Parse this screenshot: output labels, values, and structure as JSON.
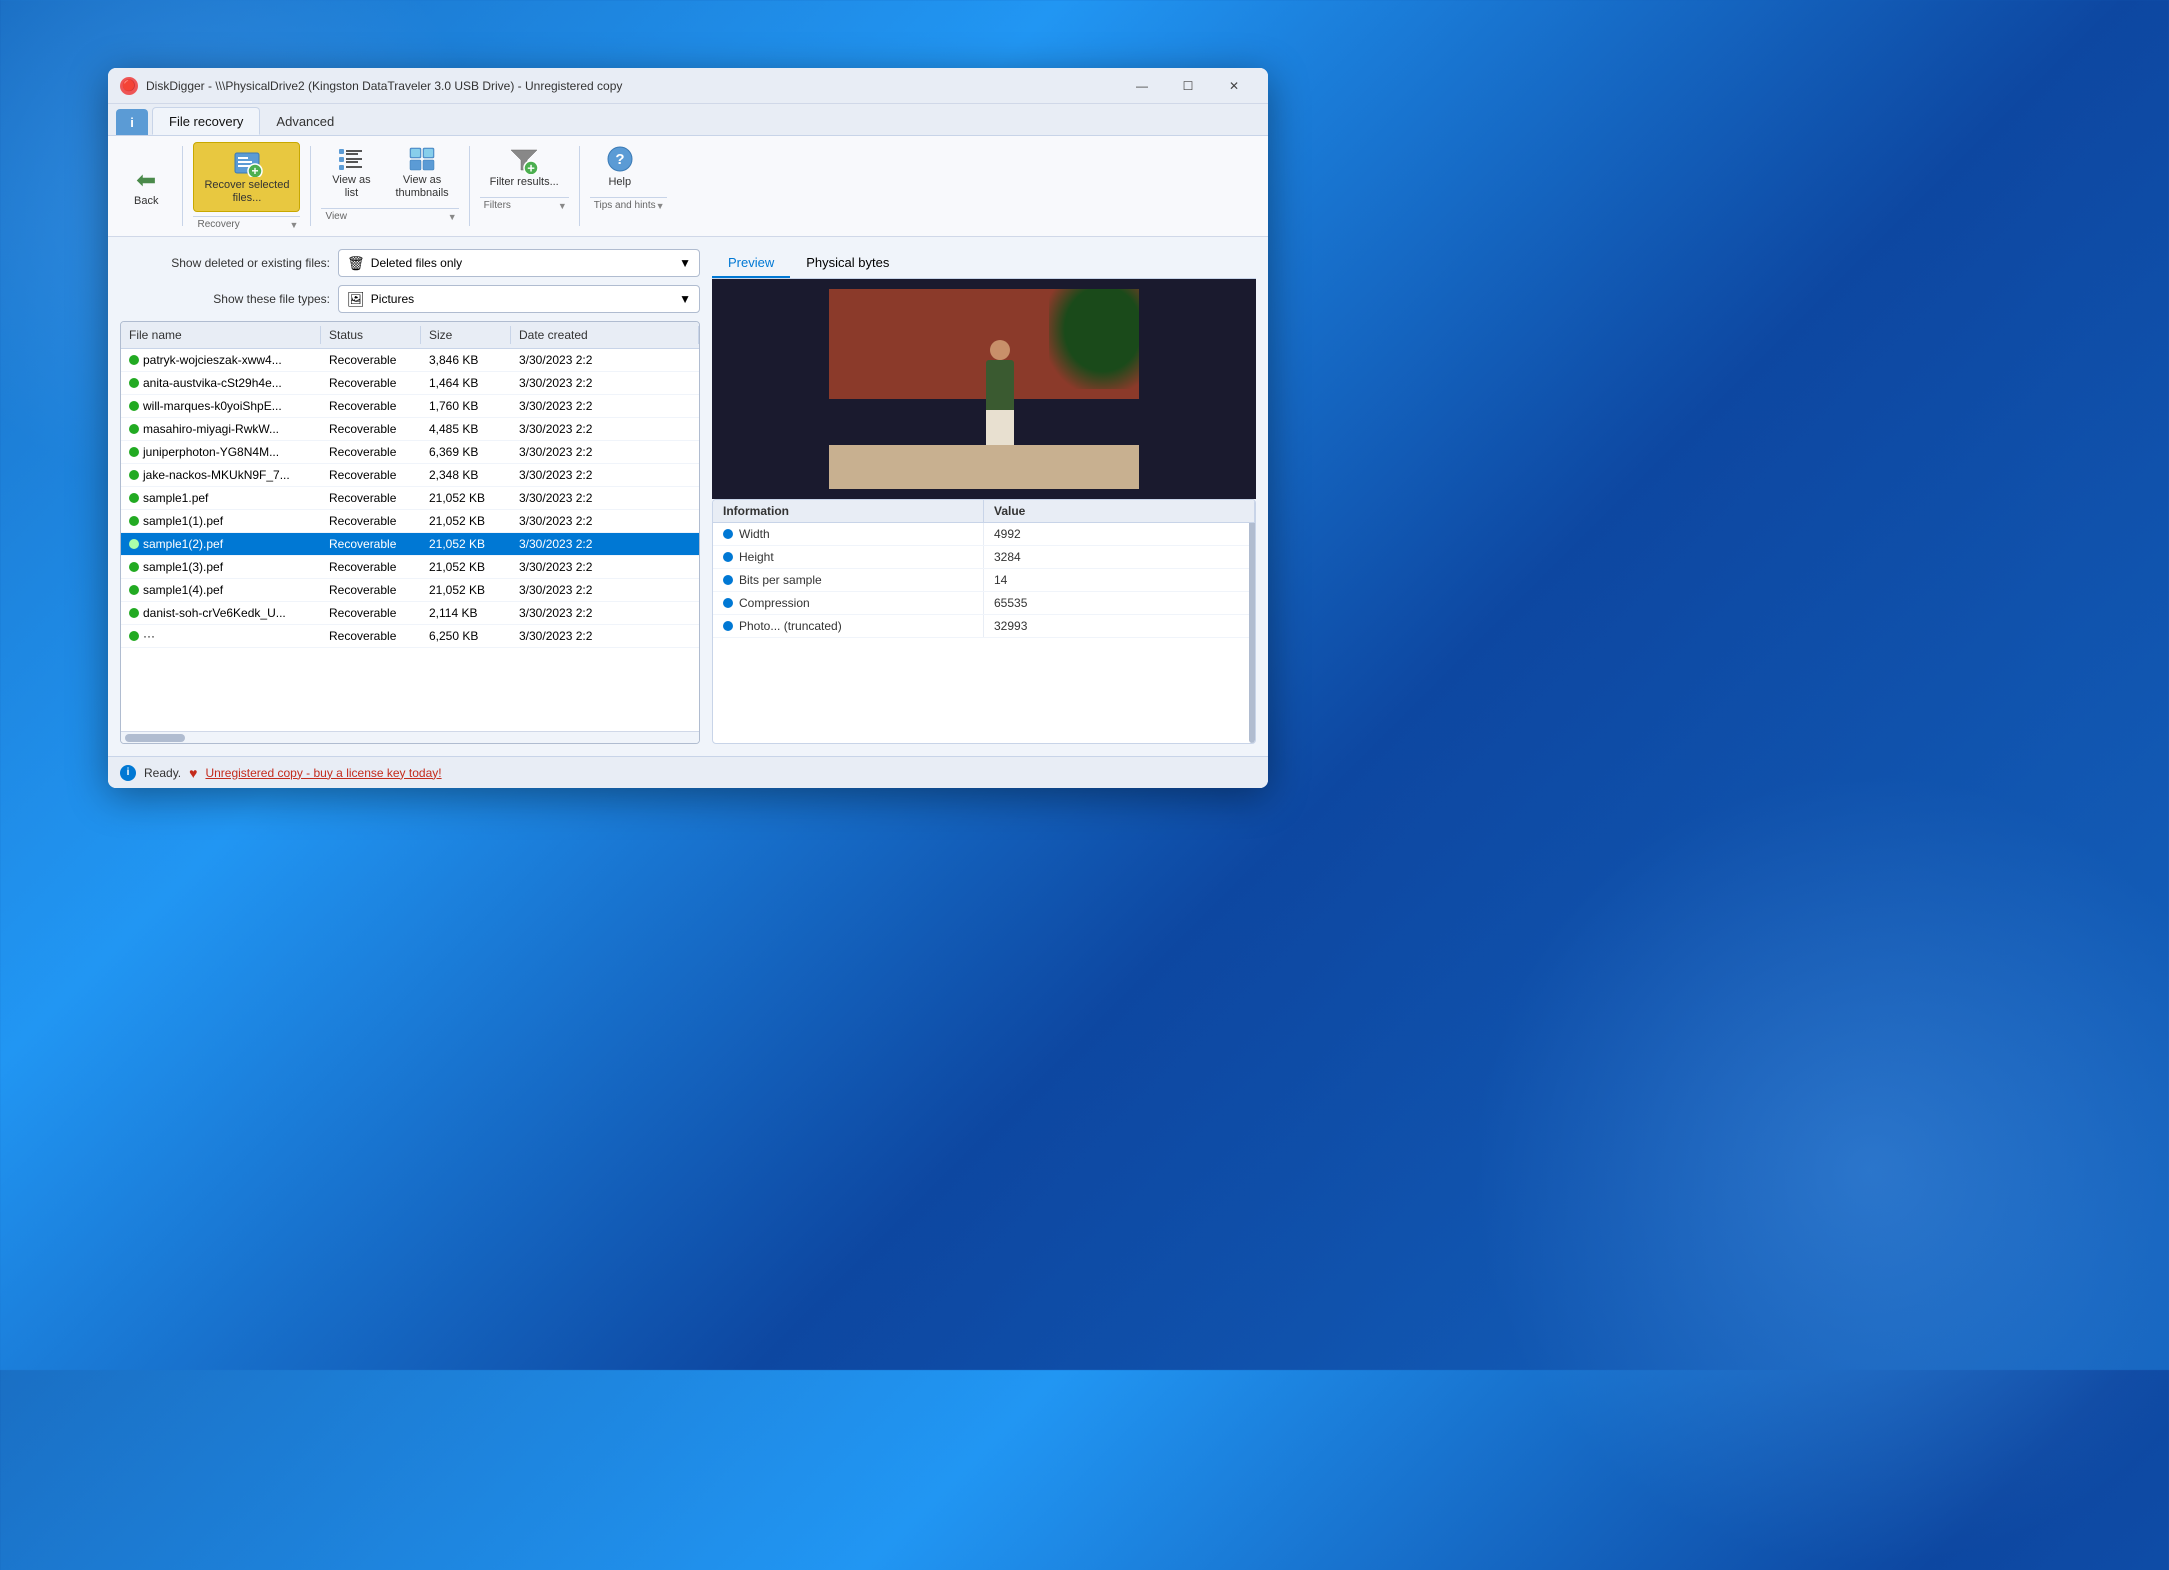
{
  "window": {
    "title": "DiskDigger - \\\\\\PhysicalDrive2 (Kingston DataTraveler 3.0 USB Drive) - Unregistered copy",
    "title_icon": "🔴",
    "controls": {
      "minimize": "—",
      "maximize": "☐",
      "close": "✕"
    }
  },
  "tabs": {
    "info_label": "i",
    "file_recovery_label": "File recovery",
    "advanced_label": "Advanced"
  },
  "toolbar": {
    "back_label": "Back",
    "recover_label": "Recover selected\nfiles...",
    "view_list_label": "View as\nlist",
    "view_thumb_label": "View as\nthumbnails",
    "filter_label": "Filter results...",
    "help_label": "Help",
    "groups": {
      "recovery_label": "Recovery",
      "view_label": "View",
      "filters_label": "Filters",
      "tips_label": "Tips and hints"
    }
  },
  "filters": {
    "deleted_label": "Show deleted or existing files:",
    "deleted_value": "Deleted files only",
    "deleted_icon": "🗑",
    "types_label": "Show these file types:",
    "types_value": "Pictures",
    "types_icon": "🖼"
  },
  "file_list": {
    "columns": [
      "File name",
      "Status",
      "Size",
      "Date created"
    ],
    "files": [
      {
        "name": "patryk-wojcieszak-xww4...",
        "status": "Recoverable",
        "size": "3,846 KB",
        "date": "3/30/2023 2:2",
        "selected": false
      },
      {
        "name": "anita-austvika-cSt29h4e...",
        "status": "Recoverable",
        "size": "1,464 KB",
        "date": "3/30/2023 2:2",
        "selected": false
      },
      {
        "name": "will-marques-k0yoiShpE...",
        "status": "Recoverable",
        "size": "1,760 KB",
        "date": "3/30/2023 2:2",
        "selected": false
      },
      {
        "name": "masahiro-miyagi-RwkW...",
        "status": "Recoverable",
        "size": "4,485 KB",
        "date": "3/30/2023 2:2",
        "selected": false
      },
      {
        "name": "juniperphoton-YG8N4M...",
        "status": "Recoverable",
        "size": "6,369 KB",
        "date": "3/30/2023 2:2",
        "selected": false
      },
      {
        "name": "jake-nackos-MKUkN9F_7...",
        "status": "Recoverable",
        "size": "2,348 KB",
        "date": "3/30/2023 2:2",
        "selected": false
      },
      {
        "name": "sample1.pef",
        "status": "Recoverable",
        "size": "21,052 KB",
        "date": "3/30/2023 2:2",
        "selected": false
      },
      {
        "name": "sample1(1).pef",
        "status": "Recoverable",
        "size": "21,052 KB",
        "date": "3/30/2023 2:2",
        "selected": false
      },
      {
        "name": "sample1(2).pef",
        "status": "Recoverable",
        "size": "21,052 KB",
        "date": "3/30/2023 2:2",
        "selected": true
      },
      {
        "name": "sample1(3).pef",
        "status": "Recoverable",
        "size": "21,052 KB",
        "date": "3/30/2023 2:2",
        "selected": false
      },
      {
        "name": "sample1(4).pef",
        "status": "Recoverable",
        "size": "21,052 KB",
        "date": "3/30/2023 2:2",
        "selected": false
      },
      {
        "name": "danist-soh-crVe6Kedk_U...",
        "status": "Recoverable",
        "size": "2,114 KB",
        "date": "3/30/2023 2:2",
        "selected": false
      },
      {
        "name": "···",
        "status": "Recoverable",
        "size": "6,250 KB",
        "date": "3/30/2023 2:2",
        "selected": false
      }
    ]
  },
  "preview": {
    "tab_preview": "Preview",
    "tab_physical": "Physical bytes"
  },
  "info_table": {
    "col_information": "Information",
    "col_value": "Value",
    "rows": [
      {
        "label": "Width",
        "value": "4992",
        "has_dot": true
      },
      {
        "label": "Height",
        "value": "3284",
        "has_dot": true
      },
      {
        "label": "Bits per sample",
        "value": "14",
        "has_dot": true
      },
      {
        "label": "Compression",
        "value": "65535",
        "has_dot": true
      },
      {
        "label": "Photo... (truncated)",
        "value": "32993",
        "has_dot": true
      }
    ]
  },
  "status_bar": {
    "ready_text": "Ready.",
    "heart_icon": "♥",
    "unregistered_text": "Unregistered copy - buy a license key today!"
  }
}
